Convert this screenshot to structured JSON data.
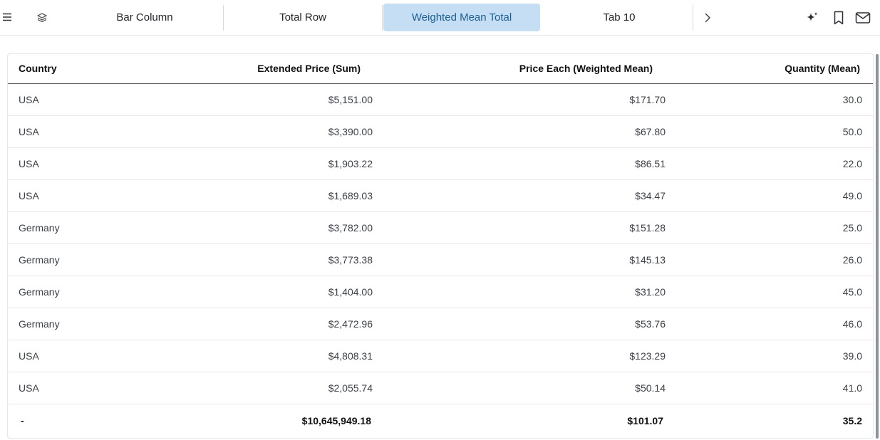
{
  "toolbar": {
    "menu_icon": "hamburger-menu-icon",
    "layers_icon": "layers-icon",
    "tabs": [
      {
        "label": "Bar Column",
        "active": false
      },
      {
        "label": "Total Row",
        "active": false
      },
      {
        "label": "Weighted Mean Total",
        "active": true
      },
      {
        "label": "Tab 10",
        "active": false
      }
    ],
    "next_icon": "chevron-right-icon",
    "actions": [
      "sparkle-icon",
      "bookmark-icon",
      "mail-icon"
    ],
    "active_tab_color": "#c5def3",
    "active_tab_text_color": "#1d5e92"
  },
  "table": {
    "columns": [
      "Country",
      "Extended Price (Sum)",
      "Price Each (Weighted Mean)",
      "Quantity (Mean)"
    ],
    "rows": [
      [
        "USA",
        "$5,151.00",
        "$171.70",
        "30.0"
      ],
      [
        "USA",
        "$3,390.00",
        "$67.80",
        "50.0"
      ],
      [
        "USA",
        "$1,903.22",
        "$86.51",
        "22.0"
      ],
      [
        "USA",
        "$1,689.03",
        "$34.47",
        "49.0"
      ],
      [
        "Germany",
        "$3,782.00",
        "$151.28",
        "25.0"
      ],
      [
        "Germany",
        "$3,773.38",
        "$145.13",
        "26.0"
      ],
      [
        "Germany",
        "$1,404.00",
        "$31.20",
        "45.0"
      ],
      [
        "Germany",
        "$2,472.96",
        "$53.76",
        "46.0"
      ],
      [
        "USA",
        "$4,808.31",
        "$123.29",
        "39.0"
      ],
      [
        "USA",
        "$2,055.74",
        "$50.14",
        "41.0"
      ]
    ],
    "total": [
      "-",
      "$10,645,949.18",
      "$101.07",
      "35.2"
    ]
  }
}
